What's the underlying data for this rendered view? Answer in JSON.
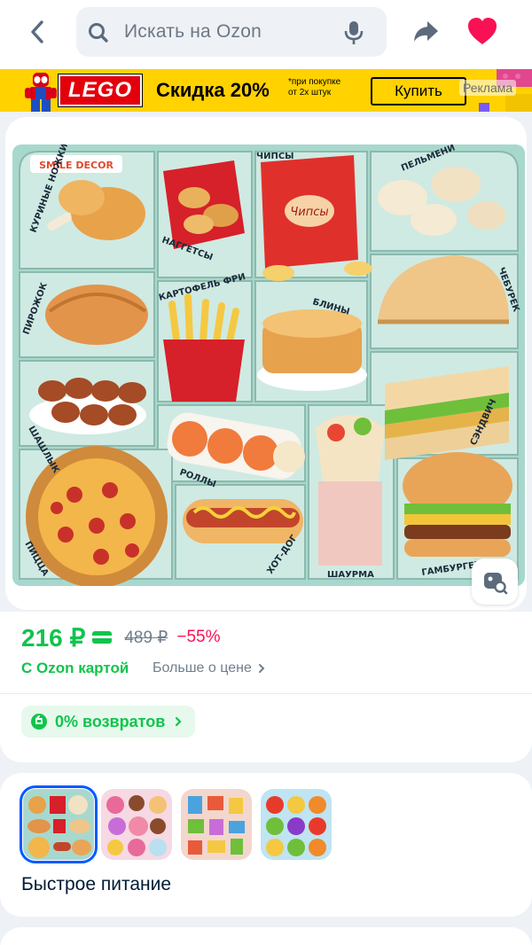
{
  "header": {
    "search_placeholder": "Искать на Ozon",
    "icons": [
      "back-arrow-icon",
      "search-icon",
      "microphone-icon",
      "share-icon",
      "heart-icon"
    ]
  },
  "banner": {
    "brand": "LEGO",
    "discount": "Скидка 20%",
    "note_line1": "*при покупке",
    "note_line2": "от 2х штук",
    "button": "Купить",
    "ad_label": "Реклама"
  },
  "product_image": {
    "alt_labels": [
      "КУРИНЫЕ НОЖКИ",
      "НАГГЕТСЫ",
      "ЧИПСЫ",
      "ПЕЛЬМЕНИ",
      "ПИРОЖОК",
      "КАРТОФЕЛЬ ФРИ",
      "БЛИНЫ",
      "ЧЕБУРЕК",
      "ШАШЛЫК",
      "РОЛЛЫ",
      "СЭНДВИЧ",
      "ПИЦЦА",
      "ХОТ-ДОГ",
      "ШАУРМА",
      "ГАМБУРГЕР"
    ],
    "brand_mark": "SMILE DECOR",
    "chips_bag_text": "Чипсы"
  },
  "price": {
    "current": "216 ₽",
    "old": "489 ₽",
    "discount": "−55%",
    "card_label": "С Ozon картой",
    "more_label": "Больше о цене"
  },
  "returns": {
    "label": "0% возвратов"
  },
  "variants": {
    "title": "Быстрое питание",
    "count": 4,
    "selected_index": 0
  },
  "colors": {
    "ozon_green": "#10c44c",
    "discount_pink": "#f91155",
    "accent_blue": "#005bff",
    "heart_pink": "#f91155",
    "banner_yellow": "#ffd200"
  }
}
